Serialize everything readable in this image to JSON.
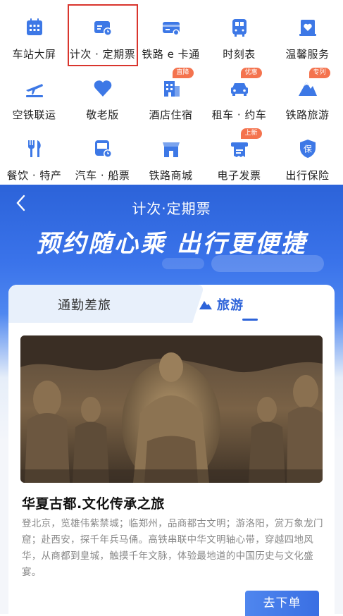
{
  "services": [
    {
      "label": "车站大屏",
      "icon": "station-screen-icon"
    },
    {
      "label": "计次 · 定期票",
      "icon": "ticket-clock-icon",
      "selected": true
    },
    {
      "label": "铁路 e 卡通",
      "icon": "rail-card-icon"
    },
    {
      "label": "时刻表",
      "icon": "timetable-icon"
    },
    {
      "label": "温馨服务",
      "icon": "heart-service-icon"
    },
    {
      "label": "空铁联运",
      "icon": "plane-train-icon"
    },
    {
      "label": "敬老版",
      "icon": "heart-icon"
    },
    {
      "label": "酒店住宿",
      "icon": "hotel-icon",
      "badge": "直降"
    },
    {
      "label": "租车 · 约车",
      "icon": "car-icon",
      "badge": "优惠"
    },
    {
      "label": "铁路旅游",
      "icon": "mountain-icon",
      "badge": "专列"
    },
    {
      "label": "餐饮 · 特产",
      "icon": "fork-knife-icon"
    },
    {
      "label": "汽车 · 船票",
      "icon": "bus-icon"
    },
    {
      "label": "铁路商城",
      "icon": "shop-icon"
    },
    {
      "label": "电子发票",
      "icon": "invoice-icon",
      "badge": "上新"
    },
    {
      "label": "出行保险",
      "icon": "insurance-shield-icon"
    }
  ],
  "page": {
    "back_icon": "chevron-left-icon",
    "title": "计次·定期票",
    "slogan": "预约随心乘 出行更便捷"
  },
  "tabs": {
    "left": "通勤差旅",
    "right": "旅游",
    "active": "旅游"
  },
  "trip": {
    "title": "华夏古都.文化传承之旅",
    "description": "登北京，览雄伟紫禁城；临郑州，品商都古文明；游洛阳，赏万象龙门窟；赴西安，探千年兵马俑。高铁串联中华文明轴心带，穿越四地风华，从商都到皇城，触摸千年文脉，体验最地道的中国历史与文化盛宴。",
    "order_button": "去下单"
  },
  "colors": {
    "brand_blue": "#2d63d9",
    "icon_blue": "#3d78e6",
    "badge_orange": "#f4734e",
    "selected_border": "#d9352d"
  }
}
